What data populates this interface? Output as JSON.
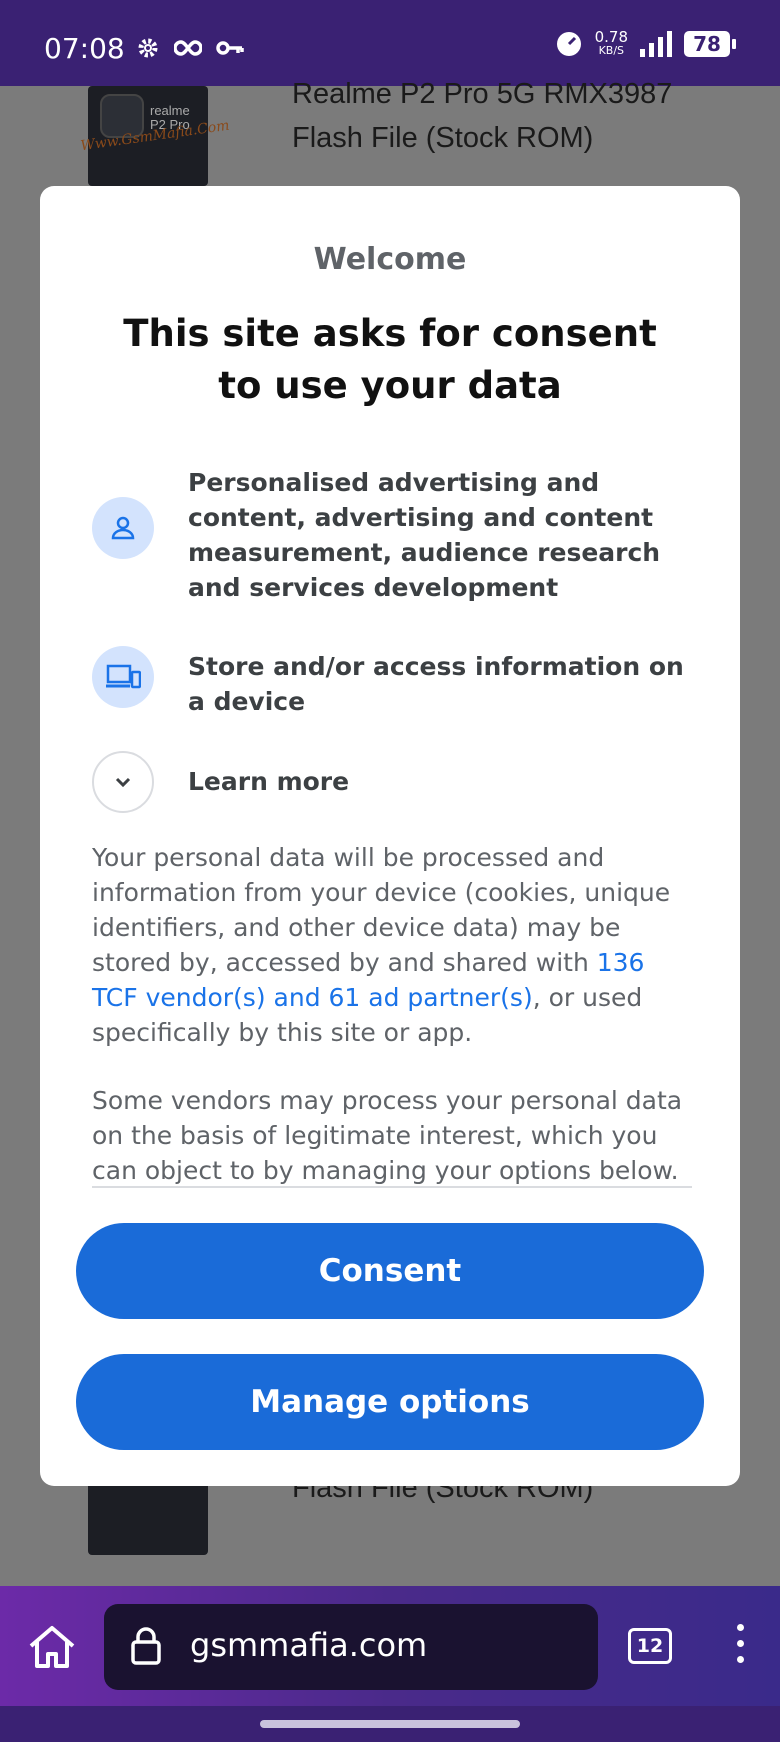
{
  "status_bar": {
    "time": "07:08",
    "net_speed_value": "0.78",
    "net_speed_unit": "KB/S",
    "battery": "78"
  },
  "background_page": {
    "item_title_top_line1": "Realme P2 Pro 5G RMX3987",
    "item_title_top_line2": "Flash File (Stock ROM)",
    "item_title_bottom": "Flash File (Stock ROM)",
    "thumb_brand": "realme P2 Pro",
    "thumb_watermark": "Www.GsmMafia.Com"
  },
  "consent_dialog": {
    "welcome": "Welcome",
    "headline": "This site asks for consent to use your data",
    "purposes": [
      {
        "icon": "person-icon",
        "text": "Personalised advertising and content, advertising and content measurement, audience research and services development"
      },
      {
        "icon": "devices-icon",
        "text": "Store and/or access information on a device"
      }
    ],
    "learn_more": "Learn more",
    "body_part1": "Your personal data will be processed and information from your device (cookies, unique identifiers, and other device data) may be stored by, accessed by and shared with ",
    "vendors_link": "136 TCF vendor(s) and 61 ad partner(s)",
    "body_part2": ", or used specifically by this site or app.",
    "body_para2": "Some vendors may process your personal data on the basis of legitimate interest, which you can object to by managing your options below. Look for a link at the bottom of this page",
    "consent_button": "Consent",
    "manage_button": "Manage options"
  },
  "browser_bar": {
    "url": "gsmmafia.com",
    "tab_count": "12"
  },
  "colors": {
    "accent": "#1a6bd8",
    "status_bar": "#3a2173",
    "icon_bg": "#d3e3fd"
  }
}
